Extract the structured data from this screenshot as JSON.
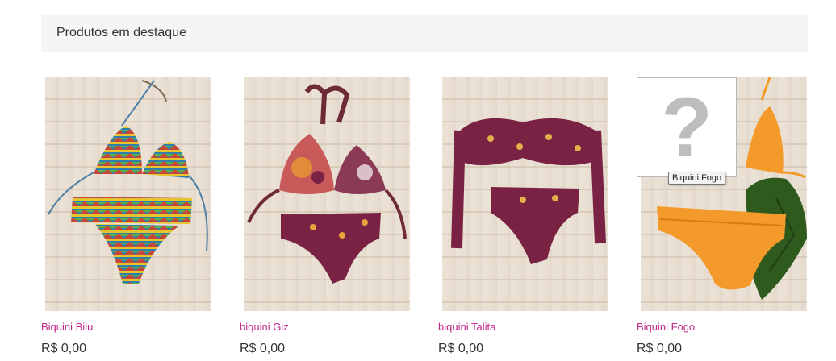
{
  "section": {
    "title": "Produtos em destaque"
  },
  "products": [
    {
      "name": "Biquini Bilu",
      "price": "R$ 0,00"
    },
    {
      "name": "biquini Giz",
      "price": "R$ 0,00"
    },
    {
      "name": "biquini Talita",
      "price": "R$ 0,00"
    },
    {
      "name": "Biquini Fogo",
      "price": "R$ 0,00"
    }
  ],
  "broken_image": {
    "glyph": "?"
  },
  "tooltip": {
    "text": "Biquini Fogo"
  },
  "colors": {
    "link": "#c2288a",
    "header_bg": "#f5f5f5",
    "wood": "#e9dfd2",
    "maroon_print": "#7a2243",
    "orange_fabric": "#f49a2a",
    "leaf": "#2f5a1e"
  }
}
